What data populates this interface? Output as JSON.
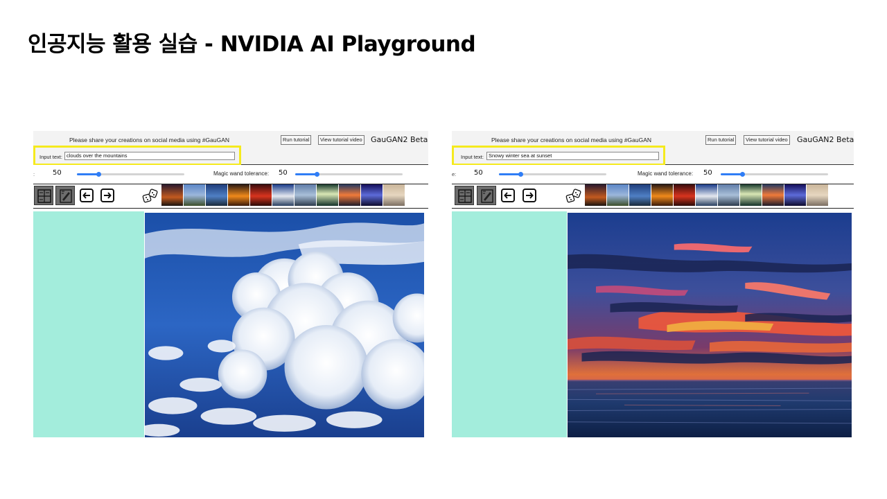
{
  "slide": {
    "title": "인공지능 활용 실습 - NVIDIA AI Playground"
  },
  "screens": {
    "left": {
      "share_text": "Please share your creations on social media using #GauGAN",
      "run_tutorial": "Run tutorial",
      "view_tutorial_video": "View tutorial video",
      "brand": "GauGAN2 Beta",
      "input_label": "Input text:",
      "input_value": "clouds over the mountains",
      "slider_left_value": "50",
      "magic_wand_label": "Magic wand tolerance:",
      "magic_wand_value": "50",
      "slider_left_level": 0.2,
      "magic_wand_level": 0.2,
      "output_description": "blue sky with towering white clouds"
    },
    "right": {
      "share_text": "Please share your creations on social media using #GauGAN",
      "run_tutorial": "Run tutorial",
      "view_tutorial_video": "View tutorial video",
      "brand": "GauGAN2 Beta",
      "input_label": "Input text:",
      "input_value": "Snowy winter sea at sunset",
      "slider_left_label_clip": "e:",
      "slider_left_value": "50",
      "magic_wand_label": "Magic wand tolerance:",
      "magic_wand_value": "50",
      "slider_left_level": 0.2,
      "magic_wand_level": 0.2,
      "output_description": "sunset over the sea with red and orange clouds"
    }
  },
  "colors": {
    "highlight": "#f5ea1e",
    "seg_map": "#a3eddc",
    "slider_accent": "#2f7df6",
    "tool_bg": "#6d6d6d"
  },
  "icons": [
    "segmentation-map-icon",
    "brush-icon",
    "arrow-left-icon",
    "arrow-right-icon",
    "dice-icon"
  ]
}
